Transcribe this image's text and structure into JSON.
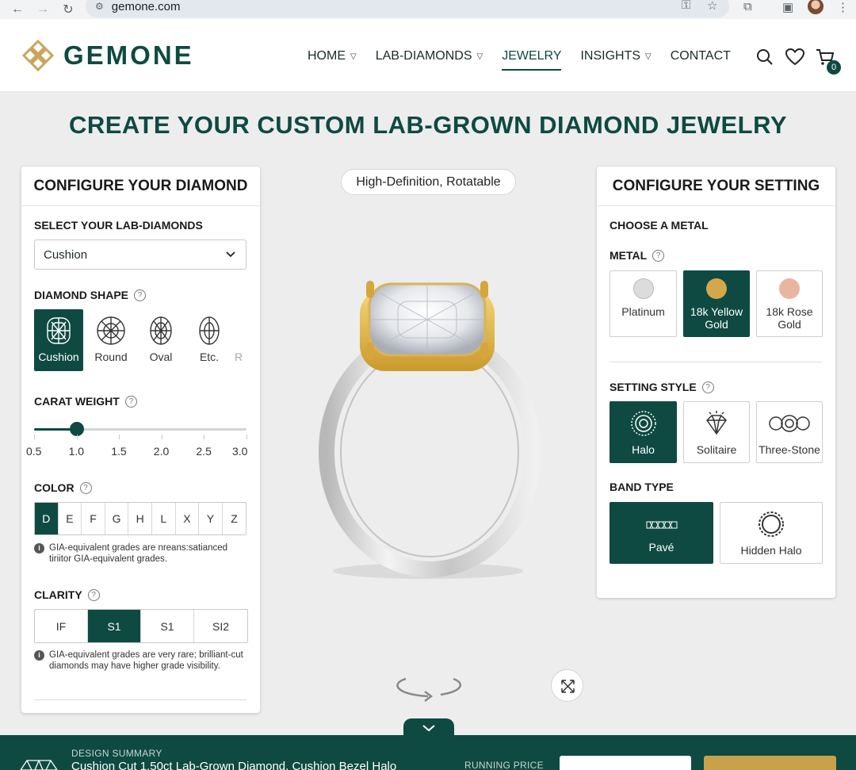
{
  "browser": {
    "url": "gemone.com"
  },
  "header": {
    "brand": "GEMONE",
    "nav": [
      {
        "label": "HOME",
        "dropdown": true
      },
      {
        "label": "LAB-DIAMONDS",
        "dropdown": true
      },
      {
        "label": "JEWELRY",
        "dropdown": false,
        "active": true
      },
      {
        "label": "INSIGHTS",
        "dropdown": true
      },
      {
        "label": "CONTACT",
        "dropdown": false
      }
    ],
    "cart_count": "0"
  },
  "page": {
    "title": "CREATE YOUR CUSTOM LAB-GROWN DIAMOND JEWELRY"
  },
  "viewer": {
    "badge": "High-Definition, Rotatable"
  },
  "diamond": {
    "title": "CONFIGURE YOUR DIAMOND",
    "select_label": "SELECT YOUR LAB-DIAMONDS",
    "select_value": "Cushion",
    "shape_label": "DIAMOND SHAPE",
    "shapes": [
      "Cushion",
      "Round",
      "Oval",
      "Etc.",
      "R"
    ],
    "selected_shape": "Cushion",
    "carat_label": "CARAT WEIGHT",
    "carat_ticks": [
      "0.5",
      "1.0",
      "1.5",
      "2.0",
      "2.5",
      "3.0"
    ],
    "carat_value": 1.0,
    "color_label": "COLOR",
    "colors": [
      "D",
      "E",
      "F",
      "G",
      "H",
      "L",
      "X",
      "Y",
      "Z"
    ],
    "selected_color": "D",
    "color_note": "GIA-equivalent grades are nreans:satianced tiriitor GIA-equivalent grades.",
    "clarity_label": "CLARITY",
    "clarities": [
      "IF",
      "S1",
      "S1",
      "SI2"
    ],
    "selected_clarity_index": 1,
    "clarity_note": "GIA-equivalent grades are very rare; brilliant-cut diamonds may have higher grade visibility."
  },
  "setting": {
    "title": "CONFIGURE YOUR SETTING",
    "metal_section": "CHOOSE A METAL",
    "metal_label": "METAL",
    "metals": [
      {
        "line1": "Platinum",
        "line2": "",
        "color": "#dcdcdc",
        "selected": false
      },
      {
        "line1": "18k Yellow",
        "line2": "Gold",
        "color": "#d4a84a",
        "selected": true
      },
      {
        "line1": "18k Rose",
        "line2": "Gold",
        "color": "#eab5a0",
        "selected": false
      }
    ],
    "style_label": "SETTING STYLE",
    "styles": [
      "Halo",
      "Solitaire",
      "Three-Stone"
    ],
    "selected_style": "Halo",
    "band_label": "BAND TYPE",
    "bands": [
      "Pavé",
      "Hidden Halo"
    ],
    "selected_band": "Pavé"
  },
  "summary": {
    "label": "DESIGN SUMMARY",
    "text": "Cushion Cut 1.50ct Lab-Grown Diamond, Cushion Bezel Halo",
    "running_price_label": "RUNNING PRICE"
  },
  "colors": {
    "brand": "#0e4a42",
    "gold": "#c7a24a"
  }
}
